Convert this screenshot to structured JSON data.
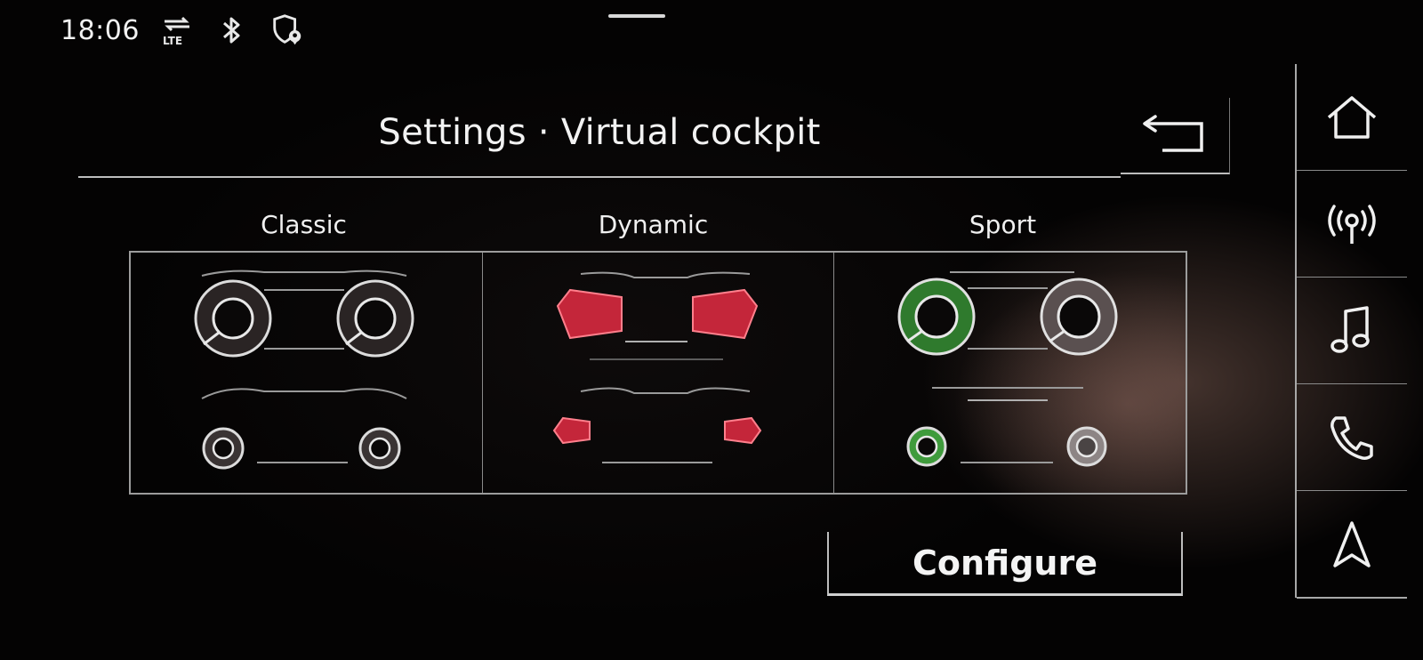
{
  "status": {
    "time": "18:06",
    "network_label": "LTE",
    "icons": [
      "lte-data-icon",
      "bluetooth-icon",
      "location-shield-icon"
    ]
  },
  "header": {
    "title": "Settings · Virtual cockpit",
    "back_icon": "back-arrow-icon"
  },
  "layouts": [
    {
      "label": "Classic",
      "style": "classic",
      "accent": "#ffffff"
    },
    {
      "label": "Dynamic",
      "style": "dynamic",
      "accent": "#d42a3a"
    },
    {
      "label": "Sport",
      "style": "sport",
      "accent": "#3f9b3c"
    }
  ],
  "configure": {
    "label": "Configure"
  },
  "nav": [
    {
      "id": "home",
      "icon": "home-icon"
    },
    {
      "id": "radio",
      "icon": "radio-antenna-icon"
    },
    {
      "id": "media",
      "icon": "music-note-icon"
    },
    {
      "id": "phone",
      "icon": "phone-icon"
    },
    {
      "id": "navigation",
      "icon": "navigation-arrow-icon"
    }
  ],
  "colors": {
    "background": "#050404",
    "text": "#f2f2f2",
    "line": "#bdbdbd",
    "dynamic_red": "#d42a3a",
    "sport_green": "#3f9b3c"
  }
}
